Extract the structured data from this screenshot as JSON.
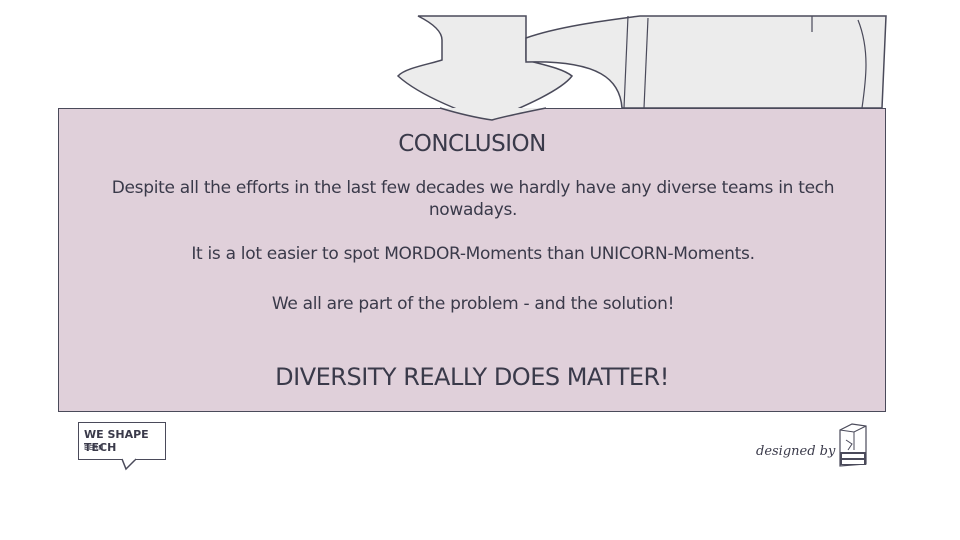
{
  "slide": {
    "title": "CONCLUSION",
    "paragraphs": [
      "Despite all the efforts in the last few decades we hardly have any diverse teams in tech nowadays.",
      "It is a lot easier to spot MORDOR-Moments than UNICORN-Moments.",
      "We all are part of the problem - and the solution!"
    ],
    "headline": "DIVERSITY REALLY DOES MATTER!"
  },
  "branding": {
    "left_logo_name": "WE SHAPE TECH",
    "left_logo_city": "BERN",
    "right_credit": "designed by",
    "right_logo_icon": "break-the-box-logo-icon"
  },
  "colors": {
    "panel": "#e0d0da",
    "outline": "#4a4a5a",
    "text": "#3a3a4a",
    "sketch_fill": "#ececec"
  }
}
